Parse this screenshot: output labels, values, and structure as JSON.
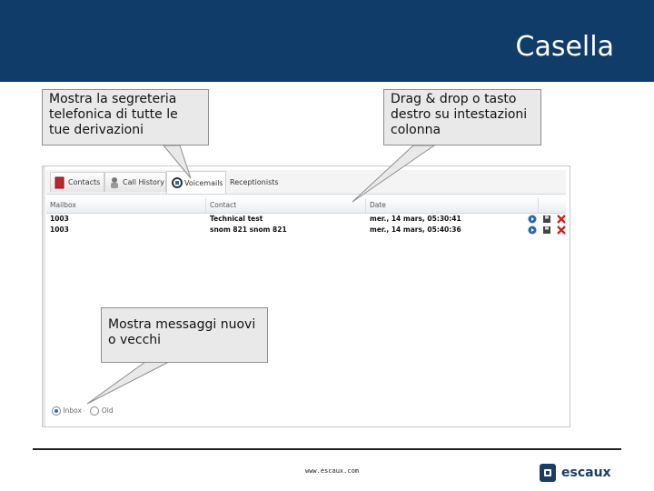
{
  "slide": {
    "title": "Casella",
    "website": "www.escaux.com",
    "logo_text": "escaux",
    "header_color": "#0f3c68"
  },
  "callouts": {
    "derivazioni": "Mostra la segreteria telefonica di tutte le tue derivazioni",
    "dragdrop": "Drag & drop o tasto destro su intestazioni colonna",
    "messaggi": "Mostra messaggi nuovi o vecchi"
  },
  "tabs": [
    {
      "label": "Contacts",
      "icon": "book-icon"
    },
    {
      "label": "Call History",
      "icon": "user-icon"
    },
    {
      "label": "Voicemails",
      "icon": "voicemail-icon"
    },
    {
      "label": "Receptionists",
      "icon": "none"
    }
  ],
  "grid": {
    "columns": [
      "Mailbox",
      "Contact",
      "Date"
    ],
    "rows": [
      {
        "mailbox": "1003",
        "contact": "Technical test",
        "date": "mer., 14 mars, 05:30:41"
      },
      {
        "mailbox": "1003",
        "contact": "snom 821 snom 821",
        "date": "mer., 14 mars, 05:40:36"
      }
    ],
    "row_actions": [
      "play-icon",
      "save-icon",
      "delete-icon"
    ]
  },
  "filter": {
    "options": [
      {
        "label": "Inbox",
        "selected": true
      },
      {
        "label": "Old",
        "selected": false
      }
    ]
  }
}
